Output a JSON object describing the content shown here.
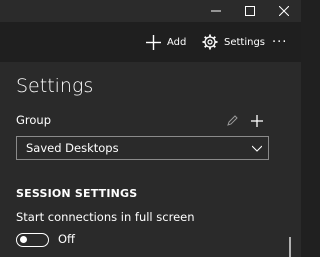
{
  "window": {
    "controls": [
      "minimize-icon",
      "maximize-icon",
      "close-icon"
    ]
  },
  "commandbar": {
    "add_label": "Add",
    "add_icon": "plus-icon",
    "settings_label": "Settings",
    "settings_icon": "gear-icon",
    "more_label": "···"
  },
  "settings": {
    "title": "Settings",
    "group_label": "Group",
    "group_icons": [
      "pencil-icon",
      "plus-icon"
    ],
    "group_value": "Saved Desktops",
    "section_heading": "SESSION SETTINGS",
    "fullscreen_label": "Start connections in full screen",
    "fullscreen_toggle_state": "Off",
    "fullscreen_on": false
  },
  "colors": {
    "background": "#202020",
    "panel": "#2a2a2a",
    "text": "#ffffff",
    "border": "#8a8a8a"
  }
}
